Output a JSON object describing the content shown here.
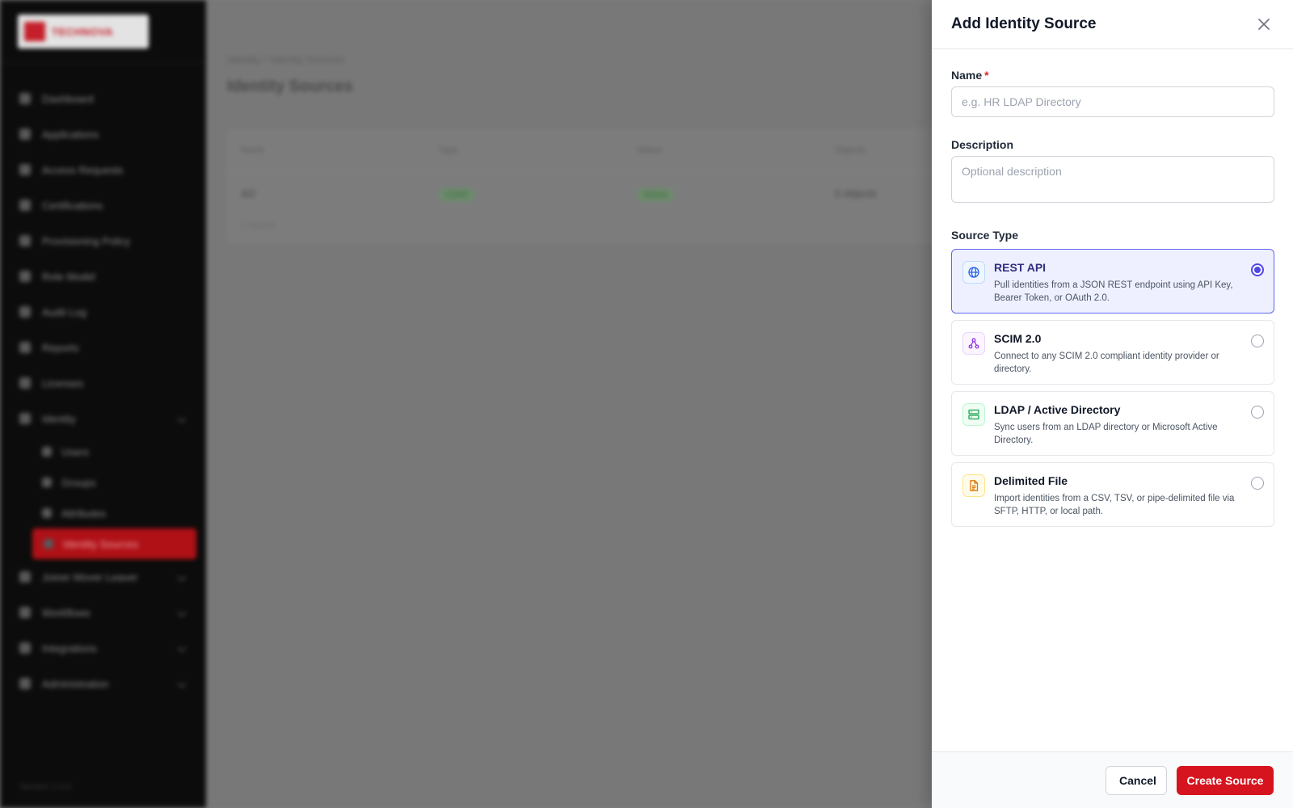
{
  "background": {
    "brand": "TECHNOVA",
    "nav": [
      "Dashboard",
      "Applications",
      "Access Requests",
      "Certifications",
      "Provisioning Policy",
      "Role Model",
      "Audit Log",
      "Reports",
      "Licenses"
    ],
    "nav_group": "Identity",
    "nav_sub": [
      "Users",
      "Groups",
      "Attributes",
      "Identity Sources"
    ],
    "nav_more": [
      "Joiner Mover Leaver",
      "Workflows",
      "Integrations",
      "Administration"
    ],
    "breadcrumb": "Identity  /  Identity Sources",
    "page_title": "Identity Sources",
    "table_headers": [
      "Name",
      "Type",
      "Status",
      "Objects"
    ],
    "table_row": [
      "AD",
      "LDAP",
      "Active",
      "0 objects"
    ],
    "table_footer": "1 source",
    "footer": "Version 1.0.0"
  },
  "drawer": {
    "title": "Add Identity Source",
    "name_label": "Name",
    "name_required_mark": "*",
    "name_placeholder": "e.g. HR LDAP Directory",
    "description_label": "Description",
    "description_placeholder": "Optional description",
    "source_type_label": "Source Type",
    "source_types": [
      {
        "name": "REST API",
        "description": "Pull identities from a JSON REST endpoint using API Key, Bearer Token, or OAuth 2.0.",
        "icon": "globe-icon",
        "selected": true
      },
      {
        "name": "SCIM 2.0",
        "description": "Connect to any SCIM 2.0 compliant identity provider or directory.",
        "icon": "network-icon",
        "selected": false
      },
      {
        "name": "LDAP / Active Directory",
        "description": "Sync users from an LDAP directory or Microsoft Active Directory.",
        "icon": "server-icon",
        "selected": false
      },
      {
        "name": "Delimited File",
        "description": "Import identities from a CSV, TSV, or pipe-delimited file via SFTP, HTTP, or local path.",
        "icon": "file-icon",
        "selected": false
      }
    ],
    "cancel_label": "Cancel",
    "submit_label": "Create Source"
  },
  "colors": {
    "accent": "#d6141f",
    "selection": "#4f46e5"
  }
}
